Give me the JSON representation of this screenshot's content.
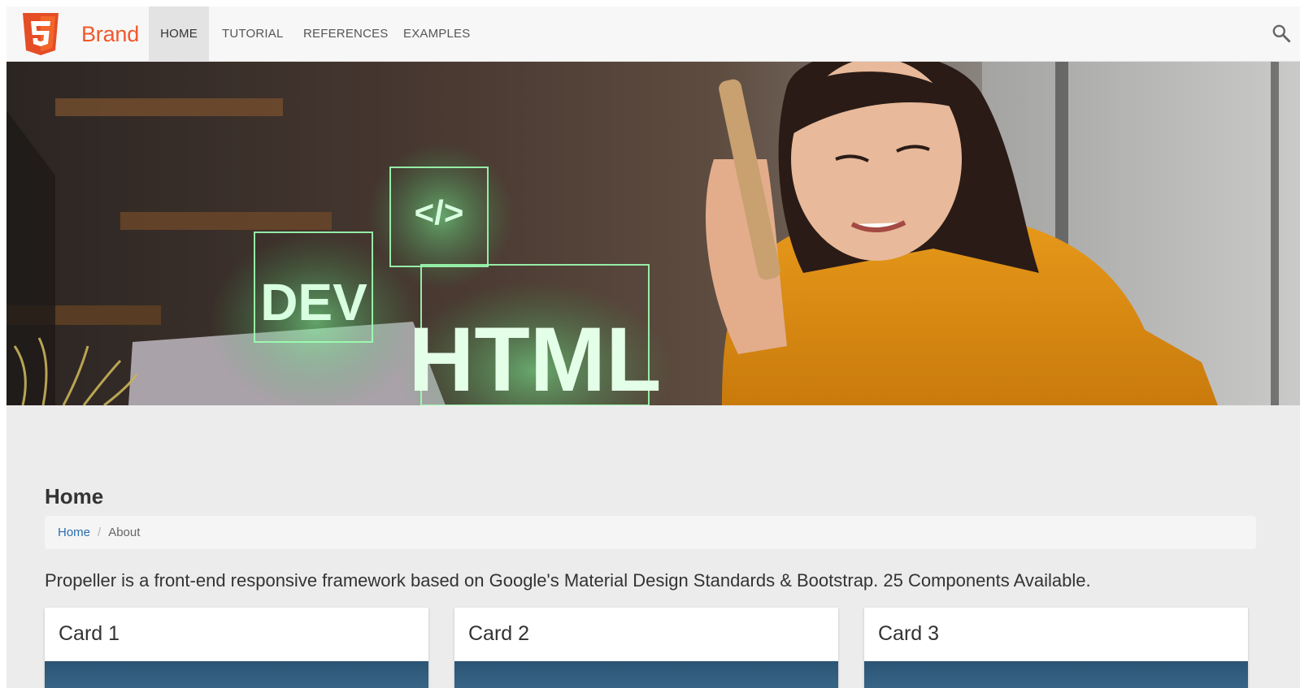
{
  "navbar": {
    "brand": "Brand",
    "items": [
      {
        "label": "HOME",
        "active": true
      },
      {
        "label": "TUTORIAL",
        "active": false
      },
      {
        "label": "REFERENCES",
        "active": false
      },
      {
        "label": "EXAMPLES",
        "active": false
      }
    ],
    "logo_icon": "html5-logo-icon",
    "search_icon": "search-icon"
  },
  "hero": {
    "overlay_texts": [
      "DEV",
      "</>",
      "HTML"
    ]
  },
  "main": {
    "title": "Home",
    "breadcrumb": {
      "link": "Home",
      "separator": "/",
      "current": "About"
    },
    "lead": "Propeller is a front-end responsive framework based on Google's Material Design Standards & Bootstrap. 25 Components Available.",
    "cards": [
      {
        "title": "Card 1"
      },
      {
        "title": "Card 2"
      },
      {
        "title": "Card 3"
      }
    ]
  },
  "colors": {
    "brand": "#f0592a",
    "link": "#2a6fb0",
    "background": "#ececec"
  }
}
